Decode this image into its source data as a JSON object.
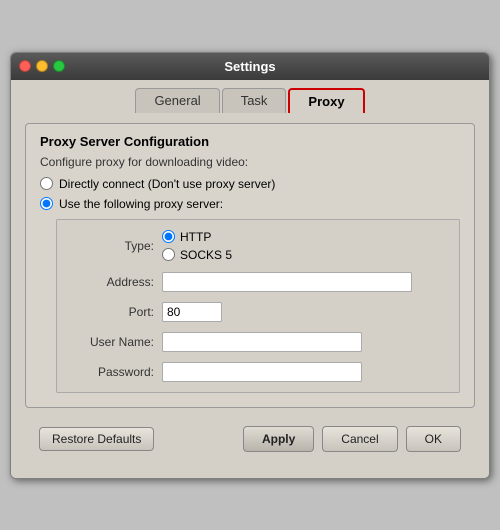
{
  "window": {
    "title": "Settings"
  },
  "tabs": [
    {
      "id": "general",
      "label": "General",
      "active": false
    },
    {
      "id": "task",
      "label": "Task",
      "active": false
    },
    {
      "id": "proxy",
      "label": "Proxy",
      "active": true
    }
  ],
  "proxy": {
    "group_title": "Proxy Server Configuration",
    "group_desc": "Configure proxy for downloading video:",
    "radio_direct": "Directly connect (Don't use proxy server)",
    "radio_use": "Use the following proxy server:",
    "type_label": "Type:",
    "type_http": "HTTP",
    "type_socks5": "SOCKS 5",
    "address_label": "Address:",
    "port_label": "Port:",
    "port_value": "80",
    "username_label": "User Name:",
    "password_label": "Password:"
  },
  "buttons": {
    "restore_defaults": "Restore Defaults",
    "apply": "Apply",
    "cancel": "Cancel",
    "ok": "OK"
  }
}
